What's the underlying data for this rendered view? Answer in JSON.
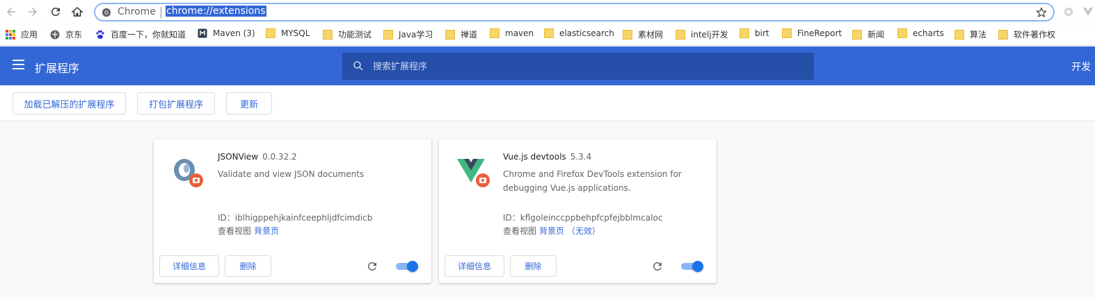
{
  "omnibox": {
    "label": "Chrome",
    "url": "chrome://extensions"
  },
  "bookmarks": [
    {
      "label": "应用",
      "icon": "apps-grid-icon"
    },
    {
      "label": "京东",
      "icon": "jd-icon"
    },
    {
      "label": "百度一下，你就知道",
      "icon": "baidu-icon"
    },
    {
      "label": "Maven (3)",
      "icon": "maven-icon"
    },
    {
      "label": "MYSQL",
      "icon": "folder-icon"
    },
    {
      "label": "功能测试",
      "icon": "folder-icon"
    },
    {
      "label": "Java学习",
      "icon": "folder-icon"
    },
    {
      "label": "禅道",
      "icon": "folder-icon"
    },
    {
      "label": "maven",
      "icon": "folder-icon"
    },
    {
      "label": "elasticsearch",
      "icon": "folder-icon"
    },
    {
      "label": "素材网",
      "icon": "folder-icon"
    },
    {
      "label": "intelj开发",
      "icon": "folder-icon"
    },
    {
      "label": "birt",
      "icon": "folder-icon"
    },
    {
      "label": "FineReport",
      "icon": "folder-icon"
    },
    {
      "label": "新闻",
      "icon": "folder-icon"
    },
    {
      "label": "echarts",
      "icon": "folder-icon"
    },
    {
      "label": "算法",
      "icon": "folder-icon"
    },
    {
      "label": "软件著作权",
      "icon": "folder-icon"
    }
  ],
  "header": {
    "title": "扩展程序",
    "search_placeholder": "搜索扩展程序",
    "dev_mode_label": "开发"
  },
  "actions": {
    "load_unpacked": "加载已解压的扩展程序",
    "pack": "打包扩展程序",
    "update": "更新"
  },
  "extensions": [
    {
      "name": "JSONView",
      "version": "0.0.32.2",
      "description": "Validate and view JSON documents",
      "id_line": "ID：iblhigppehjkainfceephljdfcimdicb",
      "views_label": "查看视图",
      "views_link": "背景页",
      "details_label": "详细信息",
      "remove_label": "删除",
      "enabled": true
    },
    {
      "name": "Vue.js devtools",
      "version": "5.3.4",
      "description": "Chrome and Firefox DevTools extension for debugging Vue.js applications.",
      "id_line": "ID：kflgoleinccppbehpfcpfejbblmcaloc",
      "views_label": "查看视图",
      "views_link": "背景页 （无效）",
      "details_label": "详细信息",
      "remove_label": "删除",
      "enabled": true
    }
  ],
  "colors": {
    "header": "#3367d6",
    "search": "#254fa8",
    "link": "#3367d6",
    "toggle": "#1a73e8"
  }
}
